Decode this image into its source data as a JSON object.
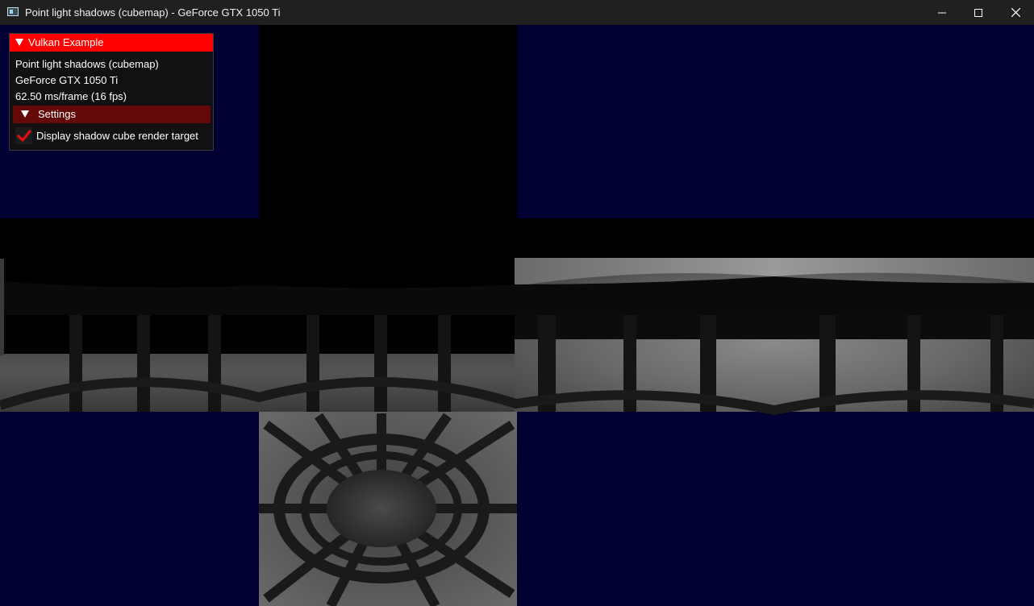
{
  "window": {
    "title": "Point light shadows (cubemap) - GeForce GTX 1050 Ti",
    "icon": "app-icon",
    "controls": [
      "minimize-icon",
      "maximize-icon",
      "close-icon"
    ]
  },
  "overlay": {
    "title": "Vulkan Example",
    "example_name": "Point light shadows (cubemap)",
    "device_name": "GeForce GTX 1050 Ti",
    "frame_time": "62.50 ms/frame (16 fps)",
    "settings": {
      "header": "Settings",
      "expanded": true,
      "checkbox_label": "Display shadow cube render target",
      "checked": true
    }
  },
  "colors": {
    "titlebar": "#202020",
    "cube_background": "#000033",
    "overlay_header": "#ff0000",
    "settings_header": "#650808",
    "checkmark": "#e01010"
  }
}
